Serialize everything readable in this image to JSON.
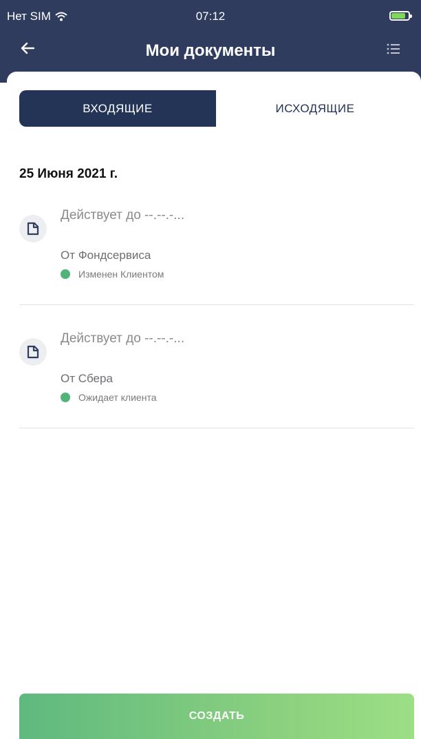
{
  "status_bar": {
    "carrier": "Нет SIM",
    "time": "07:12",
    "wifi_icon": "wifi-icon",
    "battery_icon": "battery-charging-icon"
  },
  "nav": {
    "title": "Мои документы",
    "back_icon": "arrow-left-icon",
    "menu_icon": "list-icon"
  },
  "tabs": [
    {
      "label": "ВХОДЯЩИЕ",
      "active": true
    },
    {
      "label": "ИСХОДЯЩИЕ",
      "active": false
    }
  ],
  "date_group": "25 Июня 2021 г.",
  "documents": [
    {
      "title": "Действует до --.--.-...",
      "from": "От Фондсервиса",
      "status": "Изменен Клиентом",
      "icon": "document-icon"
    },
    {
      "title": "Действует до --.--.-...",
      "from": "От Сбера",
      "status": "Ожидает клиента",
      "icon": "document-icon"
    }
  ],
  "create_button": "СОЗДАТЬ",
  "colors": {
    "header": "#2f3c5e",
    "tab_active": "#233457",
    "status_green": "#52b37a",
    "button_gradient_start": "#5fb97f",
    "button_gradient_end": "#9cdf86"
  }
}
